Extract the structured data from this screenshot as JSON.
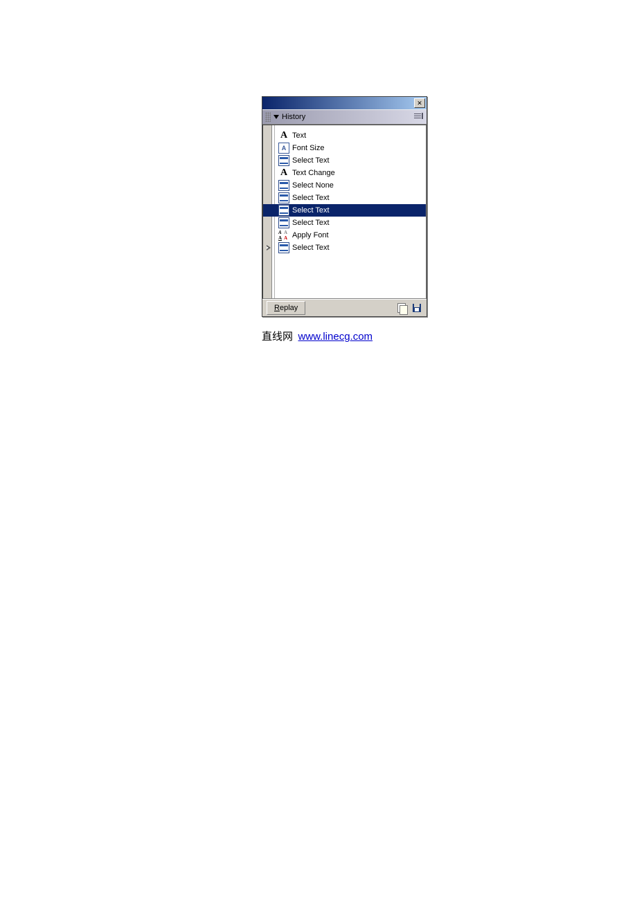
{
  "panel": {
    "title": "History",
    "items": [
      {
        "icon": "text-a",
        "label": "Text",
        "selected": false,
        "current": false
      },
      {
        "icon": "fontsize",
        "label": "Font Size",
        "selected": false,
        "current": false
      },
      {
        "icon": "select",
        "label": "Select Text",
        "selected": false,
        "current": false
      },
      {
        "icon": "text-a",
        "label": "Text Change",
        "selected": false,
        "current": false
      },
      {
        "icon": "select",
        "label": "Select None",
        "selected": false,
        "current": false
      },
      {
        "icon": "select",
        "label": "Select Text",
        "selected": false,
        "current": false
      },
      {
        "icon": "select",
        "label": "Select Text",
        "selected": true,
        "current": false
      },
      {
        "icon": "select",
        "label": "Select Text",
        "selected": false,
        "current": false
      },
      {
        "icon": "applyfont",
        "label": "Apply Font",
        "selected": false,
        "current": false
      },
      {
        "icon": "select",
        "label": "Select Text",
        "selected": false,
        "current": true
      }
    ],
    "footer": {
      "replay_label": "Replay"
    }
  },
  "caption": {
    "prefix": "直线网",
    "link_text": "www.linecg.com"
  }
}
